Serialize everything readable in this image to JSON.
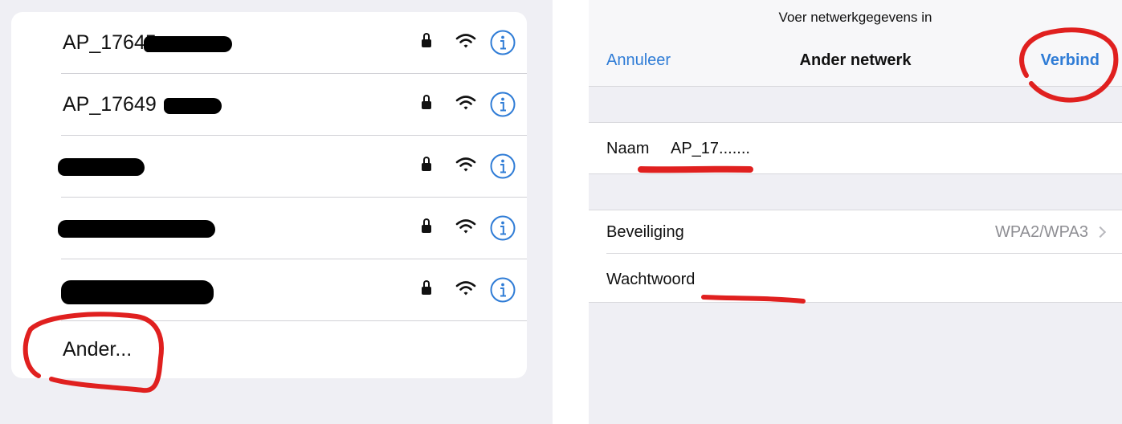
{
  "networks_list": {
    "items": [
      {
        "name": "AP_17645"
      },
      {
        "name": "AP_17649"
      },
      {
        "name": ""
      },
      {
        "name": ""
      },
      {
        "name": ""
      }
    ],
    "other_label": "Ander..."
  },
  "network_form": {
    "prompt": "Voer netwerkgegevens in",
    "cancel_label": "Annuleer",
    "title": "Ander netwerk",
    "connect_label": "Verbind",
    "name_label": "Naam",
    "name_value": "AP_17.......",
    "security_label": "Beveiliging",
    "security_value": "WPA2/WPA3",
    "password_label": "Wachtwoord"
  },
  "icons": {
    "lock": "lock-icon",
    "wifi": "wifi-icon",
    "info": "info-icon",
    "chevron": "chevron-right-icon"
  },
  "colors": {
    "accent": "#2f7cd6",
    "annotation": "#e0201f",
    "redaction": "#000000"
  }
}
